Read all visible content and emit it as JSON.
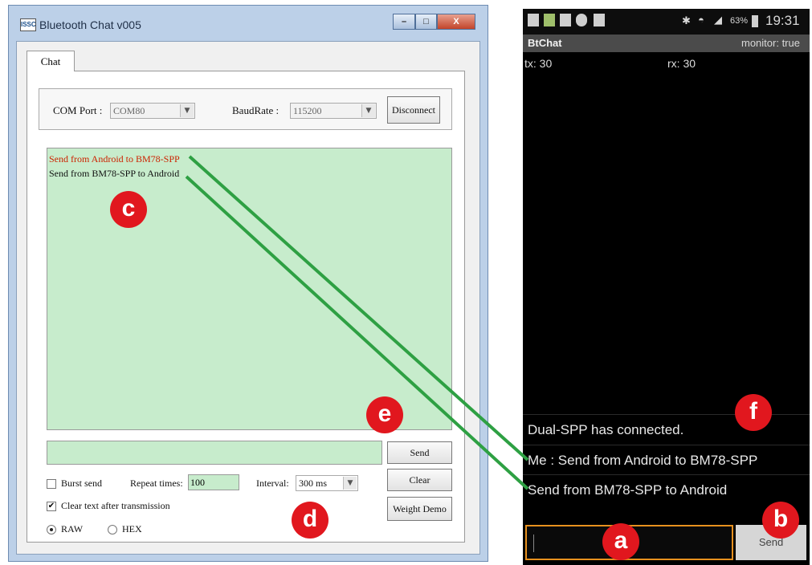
{
  "window": {
    "icon_text": "ISSC",
    "title": "Bluetooth Chat v005",
    "controls": {
      "minimize": "–",
      "maximize": "□",
      "close": "X"
    }
  },
  "tab": {
    "label": "Chat"
  },
  "settings": {
    "com_port_label": "COM Port :",
    "com_port_value": "COM80",
    "baud_label": "BaudRate :",
    "baud_value": "115200",
    "disconnect_label": "Disconnect"
  },
  "log": {
    "lines": [
      {
        "text": "Send  from Android to BM78-SPP",
        "color": "#cc2200"
      },
      {
        "text": "Send from BM78-SPP to Android",
        "color": "#111111"
      }
    ]
  },
  "send_panel": {
    "send_label": "Send",
    "clear_label": "Clear",
    "weight_demo_label": "Weight Demo",
    "burst_send_label": "Burst send",
    "burst_send_checked": false,
    "repeat_label": "Repeat times:",
    "repeat_value": "100",
    "interval_label": "Interval:",
    "interval_value": "300 ms",
    "clear_after_label": "Clear text after transmission",
    "clear_after_checked": true,
    "raw_label": "RAW",
    "hex_label": "HEX",
    "mode_selected": "RAW"
  },
  "badges": {
    "a": "a",
    "b": "b",
    "c": "c",
    "d": "d",
    "e": "e",
    "f": "f"
  },
  "phone": {
    "battery": "63%",
    "time": "19:31",
    "app_title": "BtChat",
    "monitor": "monitor: true",
    "tx": "tx: 30",
    "rx": "rx: 30",
    "messages": [
      "Dual-SPP has connected.",
      "Me : Send  from Android to BM78-SPP",
      "Send from BM78-SPP to Android"
    ],
    "send_label": "Send"
  },
  "colors": {
    "connector": "#2ea043",
    "badge": "#e1171e",
    "log_bg": "#c7eccc",
    "phone_input_border": "#e6901e"
  }
}
